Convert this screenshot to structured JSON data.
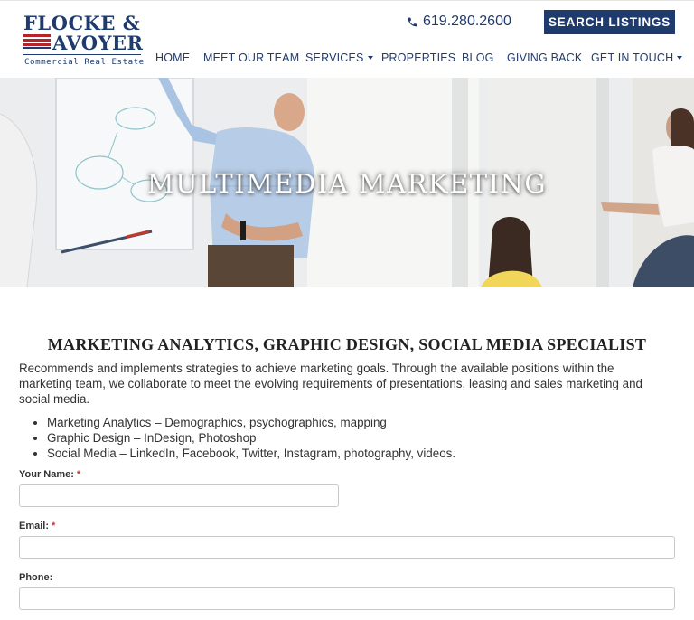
{
  "brand": {
    "name_line1": "FLOCKE &",
    "name_line2": "AVOYER",
    "tagline": "Commercial Real Estate",
    "primary_color": "#1f3b6e",
    "accent_color": "#b5242b"
  },
  "header": {
    "phone_icon": "phone-icon",
    "phone": "619.280.2600",
    "search_label": "SEARCH LISTINGS"
  },
  "nav": {
    "items": [
      {
        "label": "HOME"
      },
      {
        "label": "MEET OUR TEAM"
      },
      {
        "label": "SERVICES"
      },
      {
        "label": "PROPERTIES"
      },
      {
        "label": "BLOG"
      },
      {
        "label": "GIVING BACK"
      },
      {
        "label": "GET IN TOUCH"
      }
    ]
  },
  "hero": {
    "title": "MULTIMEDIA MARKETING"
  },
  "content": {
    "heading": "MARKETING ANALYTICS, GRAPHIC DESIGN, SOCIAL MEDIA SPECIALIST",
    "intro": "Recommends and implements strategies to achieve marketing goals. Through the available positions within the marketing team, we collaborate to meet the evolving requirements of presentations, leasing and sales marketing and social media.",
    "bullets": [
      "Marketing Analytics – Demographics, psychographics, mapping",
      "Graphic Design – InDesign, Photoshop",
      "Social Media – LinkedIn, Facebook, Twitter, Instagram, photography, videos."
    ]
  },
  "form": {
    "name_label": "Your Name:",
    "email_label": "Email:",
    "phone_label": "Phone:",
    "required_mark": "*",
    "name_value": "",
    "email_value": "",
    "phone_value": ""
  }
}
